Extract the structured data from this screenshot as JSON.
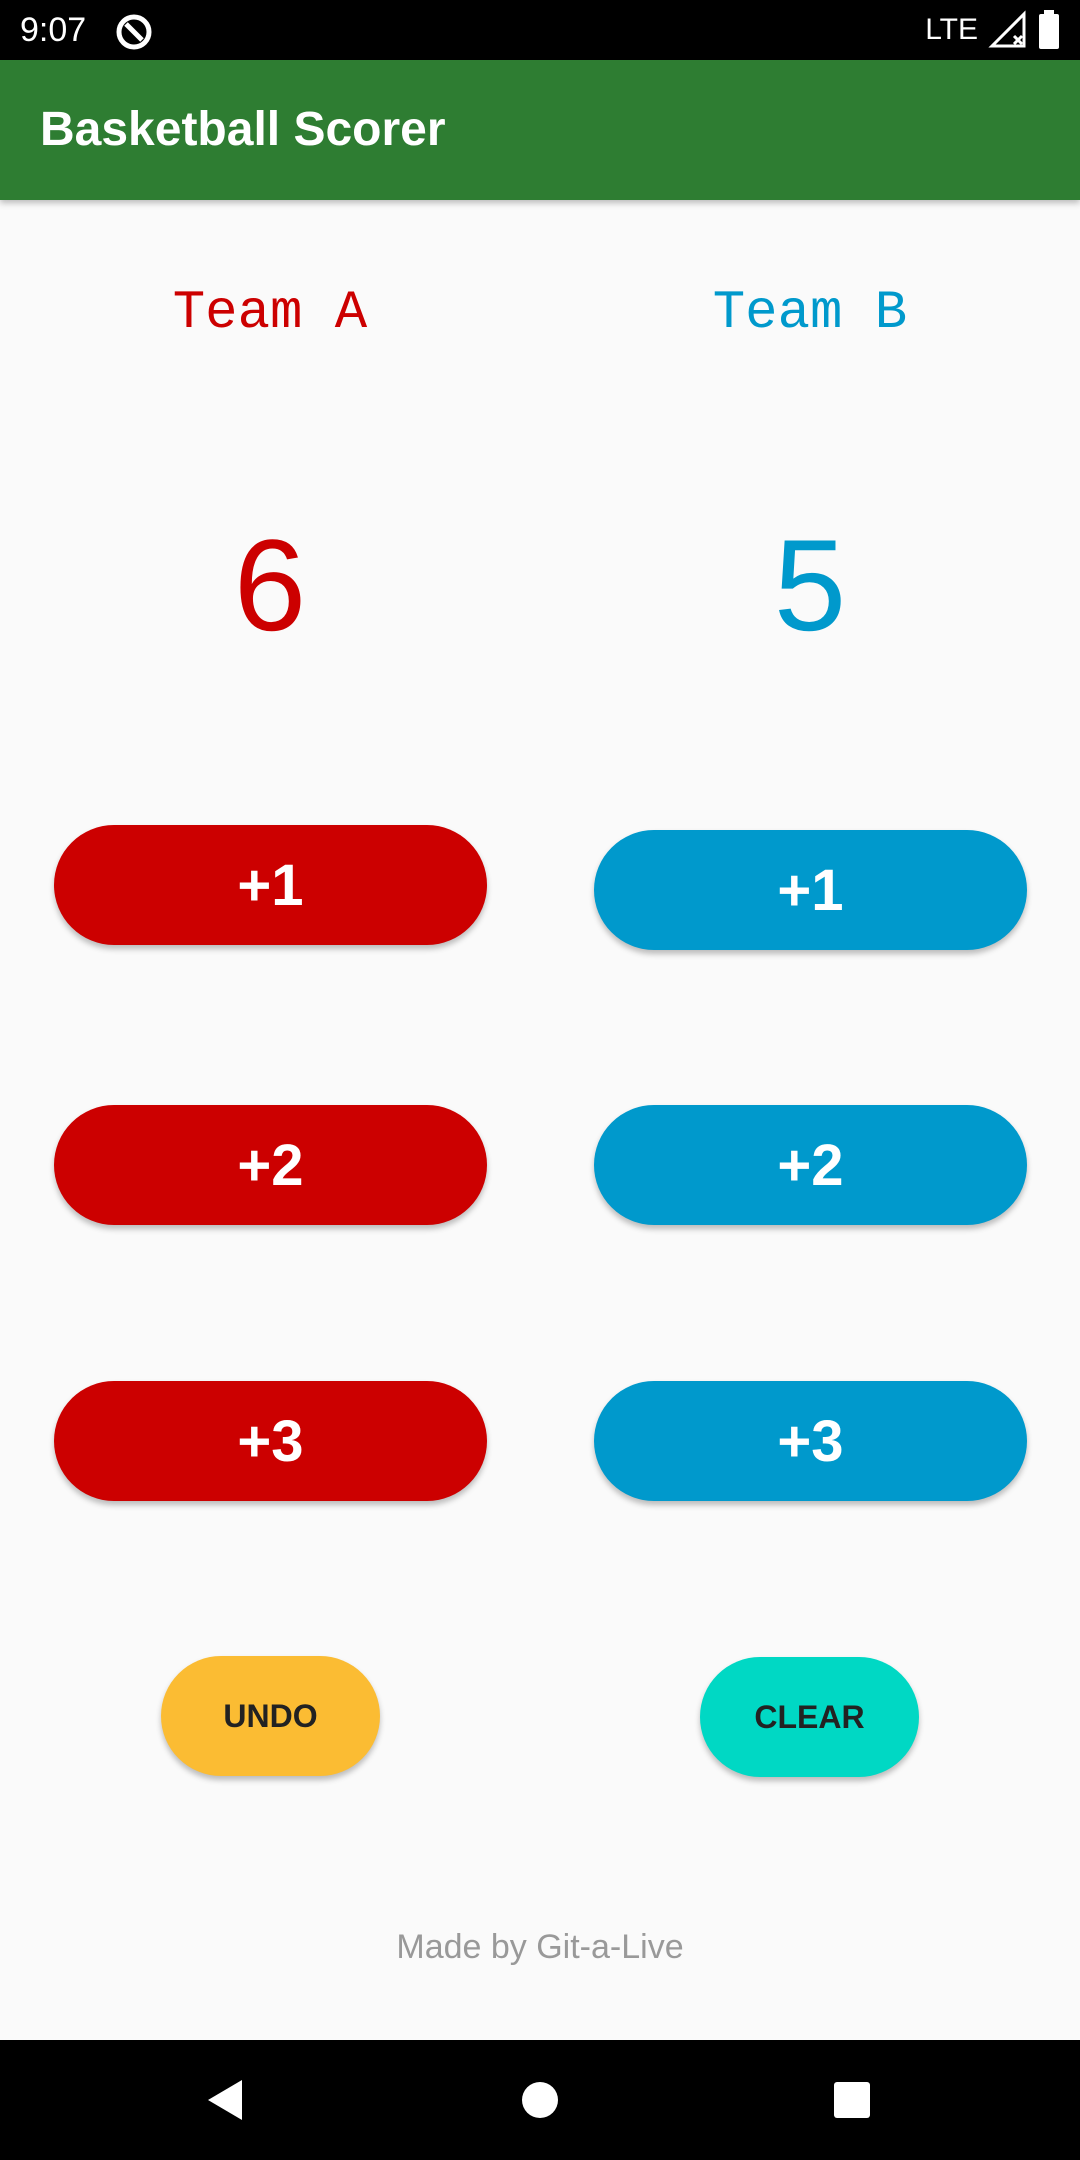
{
  "status_bar": {
    "time": "9:07",
    "network": "LTE",
    "icons": [
      "app-notification-icon",
      "signal-icon",
      "battery-icon"
    ]
  },
  "app_bar": {
    "title": "Basketball Scorer",
    "color": "#2e7d32"
  },
  "team_a": {
    "name": "Team A",
    "score": "6",
    "color": "#cc0000",
    "buttons": [
      "+1",
      "+2",
      "+3"
    ]
  },
  "team_b": {
    "name": "Team B",
    "score": "5",
    "color": "#0099cc",
    "buttons": [
      "+1",
      "+2",
      "+3"
    ]
  },
  "actions": {
    "undo_label": "UNDO",
    "undo_color": "#fbbc33",
    "clear_label": "CLEAR",
    "clear_color": "#00d8c4"
  },
  "footer": "Made by Git-a-Live",
  "nav_bar": {
    "icons": [
      "back-icon",
      "home-icon",
      "recents-icon"
    ]
  }
}
